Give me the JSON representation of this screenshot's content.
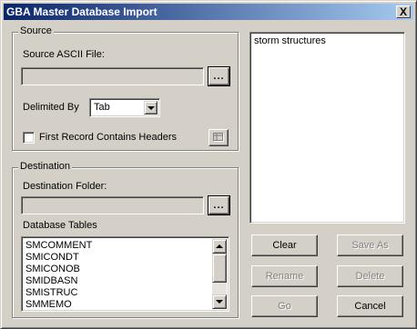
{
  "window": {
    "title": "GBA Master Database Import",
    "close_glyph": "X"
  },
  "source": {
    "group_label": "Source",
    "file_label": "Source ASCII File:",
    "file_value": "",
    "browse_label": "...",
    "delimited_label": "Delimited By",
    "delimiter_value": "Tab",
    "headers_label": "First Record Contains Headers",
    "headers_checked": false
  },
  "destination": {
    "group_label": "Destination",
    "folder_label": "Destination Folder:",
    "folder_value": "",
    "browse_label": "...",
    "tables_label": "Database Tables",
    "tables": [
      "SMCOMMENT",
      "SMICONDT",
      "SMICONOB",
      "SMIDBASN",
      "SMISTRUC",
      "SMMEMO"
    ]
  },
  "selection_list": {
    "items": [
      "storm structures"
    ]
  },
  "buttons": {
    "clear": "Clear",
    "save_as": "Save As",
    "rename": "Rename",
    "delete": "Delete",
    "go": "Go",
    "cancel": "Cancel"
  },
  "icons": {
    "close": "close-icon",
    "dropdown": "chevron-down-icon",
    "table_icon": "grid-table-icon"
  }
}
